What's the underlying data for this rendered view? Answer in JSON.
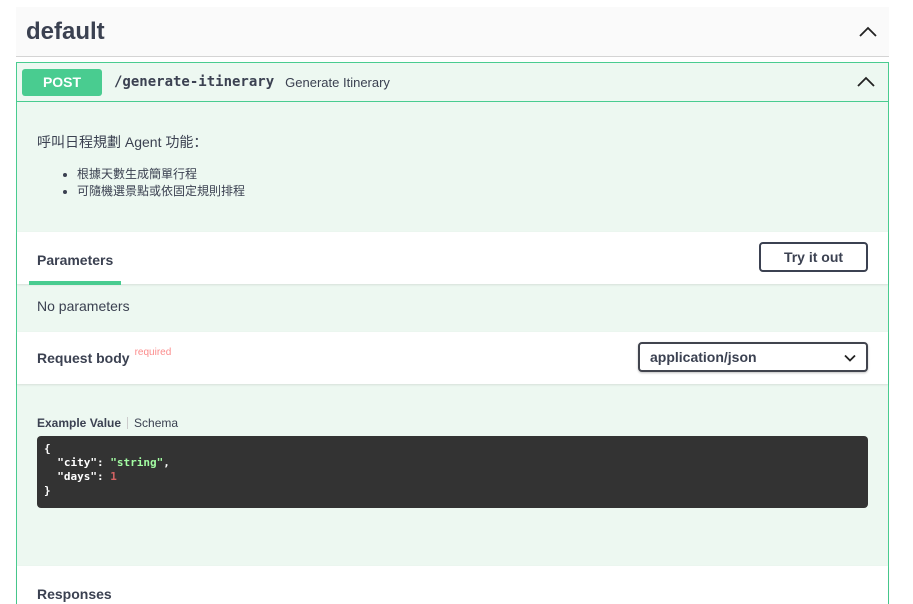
{
  "section": {
    "title": "default"
  },
  "operation": {
    "method": "POST",
    "path": "/generate-itinerary",
    "summary": "Generate Itinerary",
    "description": "呼叫日程規劃 Agent 功能：",
    "bullets": [
      "根據天數生成簡單行程",
      "可隨機選景點或依固定規則排程"
    ]
  },
  "parameters": {
    "tab_label": "Parameters",
    "try_label": "Try it out",
    "empty_text": "No parameters"
  },
  "request_body": {
    "title": "Request body",
    "required_label": "required",
    "content_type": "application/json"
  },
  "example": {
    "tab_example": "Example Value",
    "tab_schema": "Schema",
    "open_brace": "{",
    "city_key": "\"city\"",
    "city_value": "\"string\"",
    "days_key": "\"days\"",
    "days_value": "1",
    "close_brace": "}"
  },
  "responses": {
    "title": "Responses"
  },
  "colors": {
    "post": "#49cc90",
    "text": "#3b4151",
    "code_bg": "#333333"
  }
}
